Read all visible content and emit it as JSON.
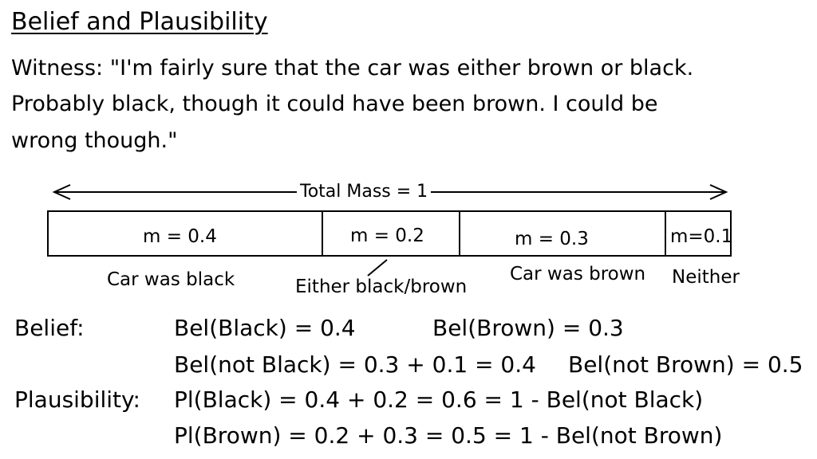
{
  "title": "Belief and Plausibility",
  "quote": [
    "Witness: \"I'm fairly sure that the car was either brown or black.",
    "Probably black, though it could have been brown. I could be",
    "wrong though.\""
  ],
  "total_mass_label": "Total Mass = 1",
  "segments": [
    {
      "mass": "m = 0.4",
      "caption": "Car was black"
    },
    {
      "mass": "m = 0.2",
      "caption": "Either black/brown"
    },
    {
      "mass": "m = 0.3",
      "caption": "Car was brown"
    },
    {
      "mass": "m=0.1",
      "caption": "Neither"
    }
  ],
  "belief": {
    "label": "Belief:",
    "bel_black": "Bel(Black) = 0.4",
    "bel_brown": "Bel(Brown) = 0.3",
    "bel_not_black": "Bel(not Black) = 0.3 + 0.1 = 0.4",
    "bel_not_brown": "Bel(not Brown) = 0.5"
  },
  "plausibility": {
    "label": "Plausibility:",
    "pl_black": "Pl(Black) = 0.4 + 0.2 = 0.6 = 1 - Bel(not Black)",
    "pl_brown": "Pl(Brown) = 0.2 + 0.3 = 0.5 = 1 - Bel(not Brown)"
  }
}
